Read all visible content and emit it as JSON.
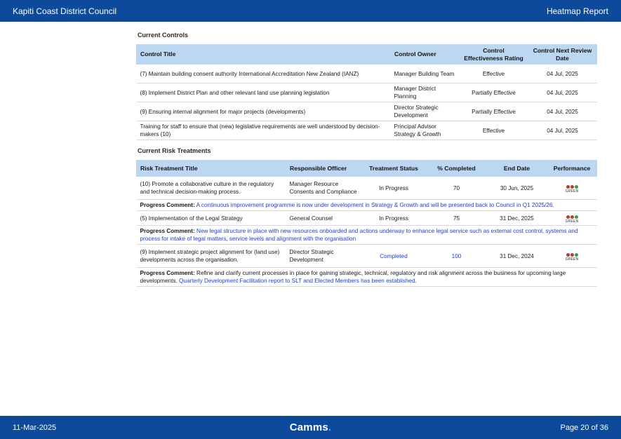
{
  "header": {
    "org": "Kapiti Coast District Council",
    "report": "Heatmap Report"
  },
  "footer": {
    "date": "11-Mar-2025",
    "logo_text": "Camms",
    "logo_dot": ".",
    "page": "Page 20 of 36"
  },
  "controls": {
    "title": "Current Controls",
    "headers": [
      "Control Title",
      "Control Owner",
      "Control Effectiveness Rating",
      "Control Next Review Date"
    ],
    "rows": [
      [
        "(7) Maintain building consent authority International Accreditation New Zealand (IANZ)",
        "Manager Building Team",
        "Effective",
        "04 Jul, 2025"
      ],
      [
        "(8) Implement District Plan and other relevant land use planning legislation",
        "Manager District Planning",
        "Partially Effective",
        "04 Jul, 2025"
      ],
      [
        "(9) Ensuring internal alignment for major projects (developments)",
        "Director Strategic Development",
        "Partially Effective",
        "04 Jul, 2025"
      ],
      [
        "Training for staff to ensure that (new) legislative requirements are well understood by decision-makers (10)",
        "Principal Advisor Strategy & Growth",
        "Effective",
        "04 Jul, 2025"
      ]
    ]
  },
  "treatments": {
    "title": "Current Risk Treatments",
    "headers": [
      "Risk Treatment Title",
      "Responsible Officer",
      "Treatment Status",
      "% Completed",
      "End Date",
      "Performance"
    ],
    "comment_label": "Progress Comment:",
    "rows": [
      {
        "title": "(10) Promote a collaborative culture in the regulatory and technical decision-making process.",
        "officer": "Manager Resource Consents and Compliance",
        "status": "In Progress",
        "completed": "70",
        "end_date": "30 Jun, 2025",
        "performance": "GREEN",
        "comment_black": "",
        "comment_blue": "A continuous improvement programme is now under development in Strategy & Growth and will be presented back to Council in Q1 2025/26."
      },
      {
        "title": "(5) Implementation of the Legal Strategy",
        "officer": "General Counsel",
        "status": "In Progress",
        "completed": "75",
        "end_date": "31 Dec, 2025",
        "performance": "GREEN",
        "comment_black": "",
        "comment_blue": "New legal structure in place with new resources onboarded and actions underway to enhance legal service such as external cost control, systems and process for intake of legal matters, service levels and alignment with the organisation"
      },
      {
        "title": "(9) Implement strategic project alignment for (land use) developments across the organisation.",
        "officer": "Director Strategic Development",
        "status": "Completed",
        "completed": "100",
        "end_date": "31 Dec, 2024",
        "performance": "GREEN",
        "comment_black": "Refine and clarify current processes in place for gaining strategic, technical, regulatory and risk alignment across the business for upcoming large developments.",
        "comment_blue": "Quarterly Development Facilitation report to SLT and Elected Members has been established."
      }
    ]
  },
  "colors": {
    "brand": "#0d4a9b",
    "header_fill": "#bcd7f2",
    "link_blue": "#1f3fd6",
    "light_red": "#c0392b",
    "light_green": "#27a844"
  }
}
